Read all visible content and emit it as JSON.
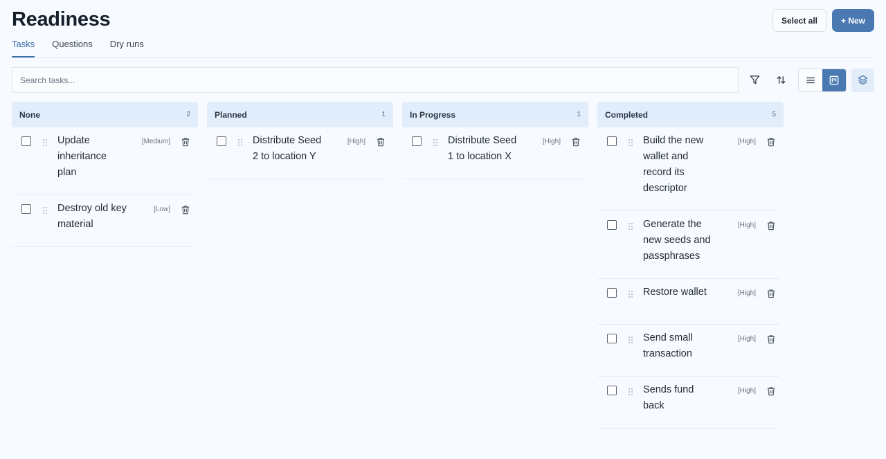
{
  "header": {
    "title": "Readiness",
    "select_all_label": "Select all",
    "new_label": "+ New"
  },
  "tabs": [
    {
      "label": "Tasks",
      "active": true
    },
    {
      "label": "Questions",
      "active": false
    },
    {
      "label": "Dry runs",
      "active": false
    }
  ],
  "search": {
    "placeholder": "Search tasks..."
  },
  "toolbar": {
    "icons": [
      "filter-icon",
      "sort-icon",
      "list-view-icon",
      "board-view-icon",
      "layers-icon"
    ],
    "active_view": "board"
  },
  "colors": {
    "accent": "#4a78b0",
    "column_header": "#e1edfb",
    "background": "#f7faff"
  },
  "columns": [
    {
      "title": "None",
      "count": "2",
      "cards": [
        {
          "text": "Update inheritance plan",
          "priority": "[Medium]"
        },
        {
          "text": "Destroy old key material",
          "priority": "[Low]"
        }
      ]
    },
    {
      "title": "Planned",
      "count": "1",
      "cards": [
        {
          "text": "Distribute Seed 2 to location Y",
          "priority": "[High]"
        }
      ]
    },
    {
      "title": "In Progress",
      "count": "1",
      "cards": [
        {
          "text": "Distribute Seed 1 to location X",
          "priority": "[High]"
        }
      ]
    },
    {
      "title": "Completed",
      "count": "5",
      "cards": [
        {
          "text": "Build the new wallet and record its descriptor",
          "priority": "[High]"
        },
        {
          "text": "Generate the new seeds and passphrases",
          "priority": "[High]"
        },
        {
          "text": "Restore wallet",
          "priority": "[High]"
        },
        {
          "text": "Send small transaction",
          "priority": "[High]"
        },
        {
          "text": "Sends fund back",
          "priority": "[High]"
        }
      ]
    }
  ]
}
